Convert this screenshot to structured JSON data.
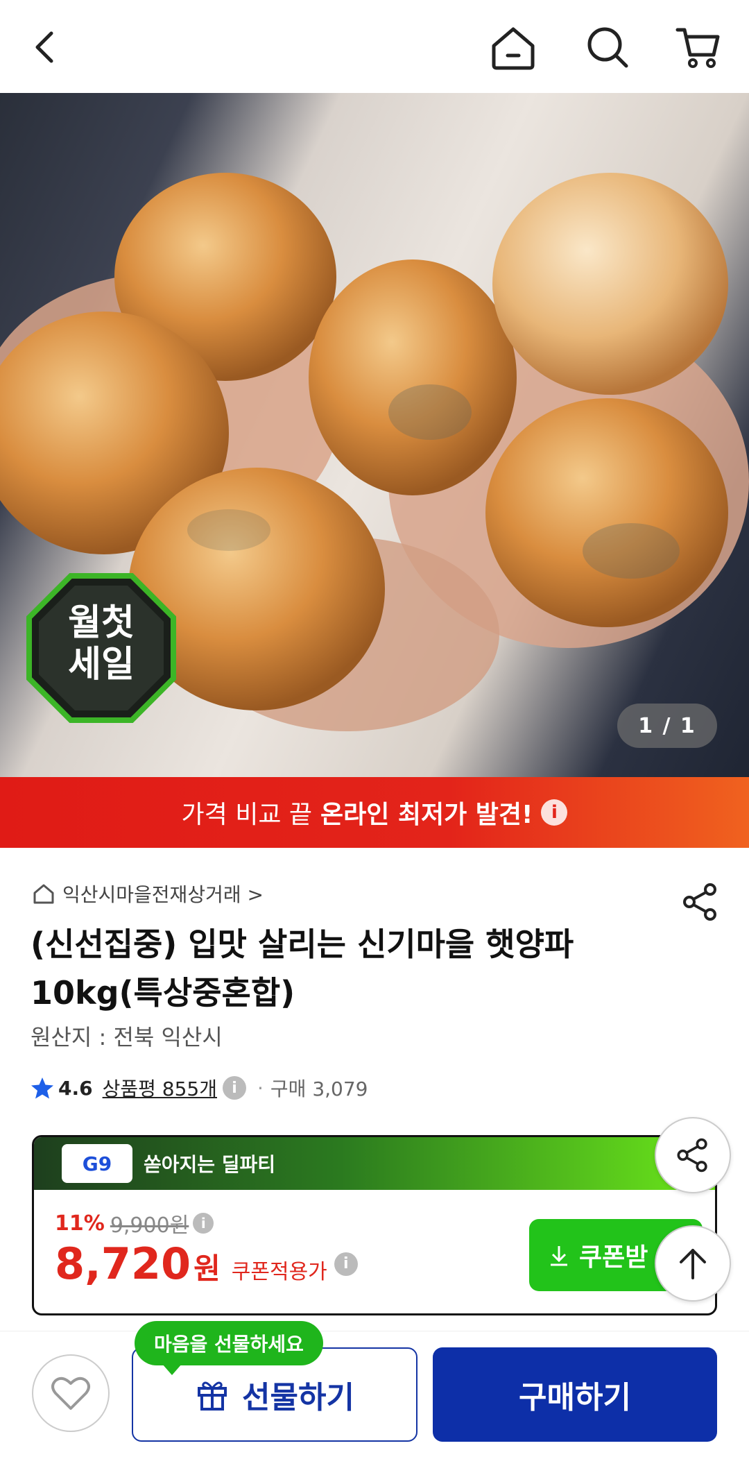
{
  "header": {
    "back_icon": "chevron-left-icon",
    "home_icon": "home-icon",
    "search_icon": "search-icon",
    "cart_icon": "cart-icon"
  },
  "gallery": {
    "counter": "1 / 1",
    "sale_badge_top": "월첫",
    "sale_badge_bottom": "세일"
  },
  "promo_banner": {
    "light_text": "가격 비교 끝",
    "bold_text": "온라인 최저가 발견!",
    "info_icon": "i"
  },
  "product": {
    "store_name": "익산시마을전재상거래 >",
    "title": "(신선집중) 입맛 살리는 신기마을 햇양파 10kg(특상중혼합)",
    "origin": "원산지 : 전북 익산시",
    "rating": "4.6",
    "review_label": "상품평 855개",
    "purchase_count": "구매 3,079"
  },
  "deal": {
    "brand_badge": "G9",
    "title": "쏟아지는 딜파티",
    "discount_pct": "11%",
    "original_price": "9,900원",
    "sale_price": "8,720",
    "currency": "원",
    "coupon_note": "쿠폰적용가",
    "coupon_button": "쿠폰받"
  },
  "bottom_bar": {
    "gift_bubble": "마음을 선물하세요",
    "gift_button": "선물하기",
    "buy_button": "구매하기"
  },
  "colors": {
    "accent_red": "#e0271d",
    "primary_blue": "#0d2fa8",
    "deal_green": "#22c31a"
  }
}
